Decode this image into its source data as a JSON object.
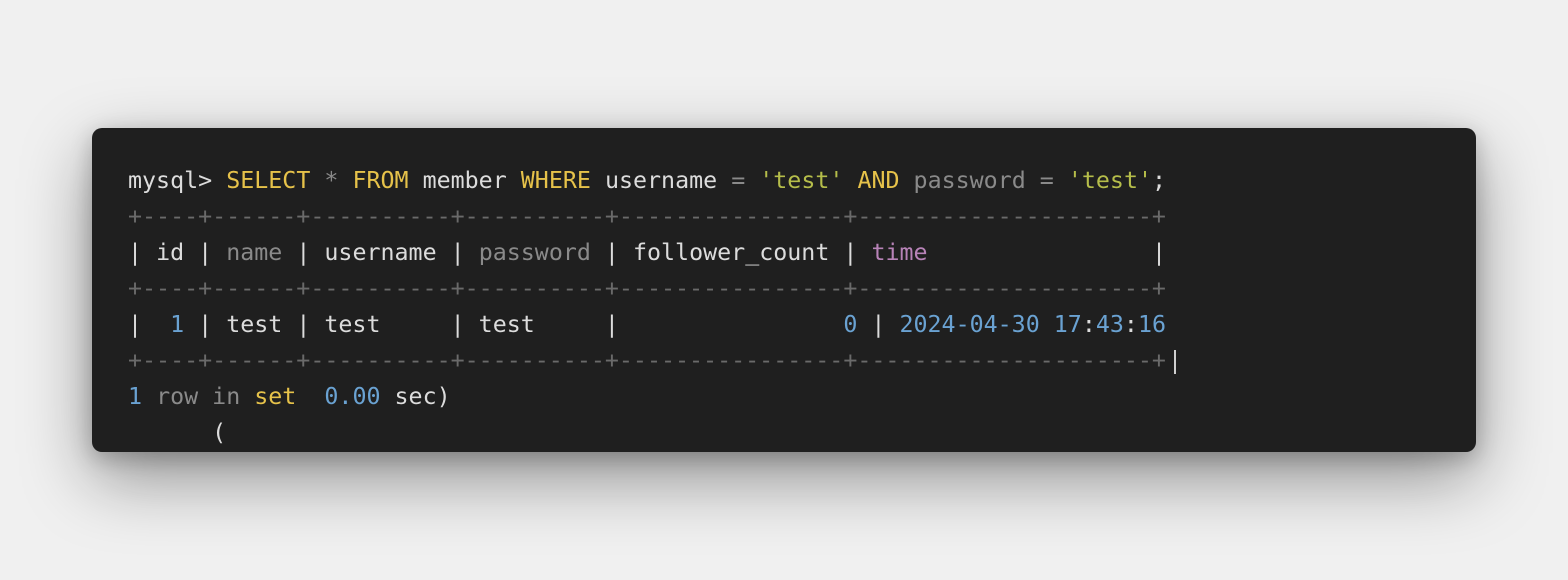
{
  "terminal": {
    "prompt": "mysql>",
    "query": {
      "select_kw": "SELECT",
      "star": "*",
      "from_kw": "FROM",
      "table": "member",
      "where_kw": "WHERE",
      "col_username": "username",
      "eq1": "=",
      "val1": "'test'",
      "and_kw": "AND",
      "col_password": "password",
      "eq2": "=",
      "val2": "'test'",
      "semicolon": ";"
    },
    "border_line": "+----+------+----------+----------+----------------+---------------------+",
    "headers": {
      "id": "id",
      "name": "name",
      "username": "username",
      "password": "password",
      "follower_count": "follower_count",
      "time": "time"
    },
    "row": {
      "id": "1",
      "name": "test",
      "username": "test",
      "password": "test",
      "follower_count": "0",
      "time_date": "2024-04-30",
      "time_h": "17",
      "time_m": "43",
      "time_s": "16"
    },
    "summary": {
      "count": "1",
      "row_in": "row in",
      "set_kw": "set",
      "open_paren": "(",
      "duration": "0.00",
      "unit": "sec)"
    },
    "colors": {
      "background": "#1f1f1f",
      "keyword": "#e6c24a",
      "string": "#b5bd4a",
      "number": "#6aa2d2",
      "muted": "#8a8a8a",
      "time_header": "#b883b8"
    }
  }
}
